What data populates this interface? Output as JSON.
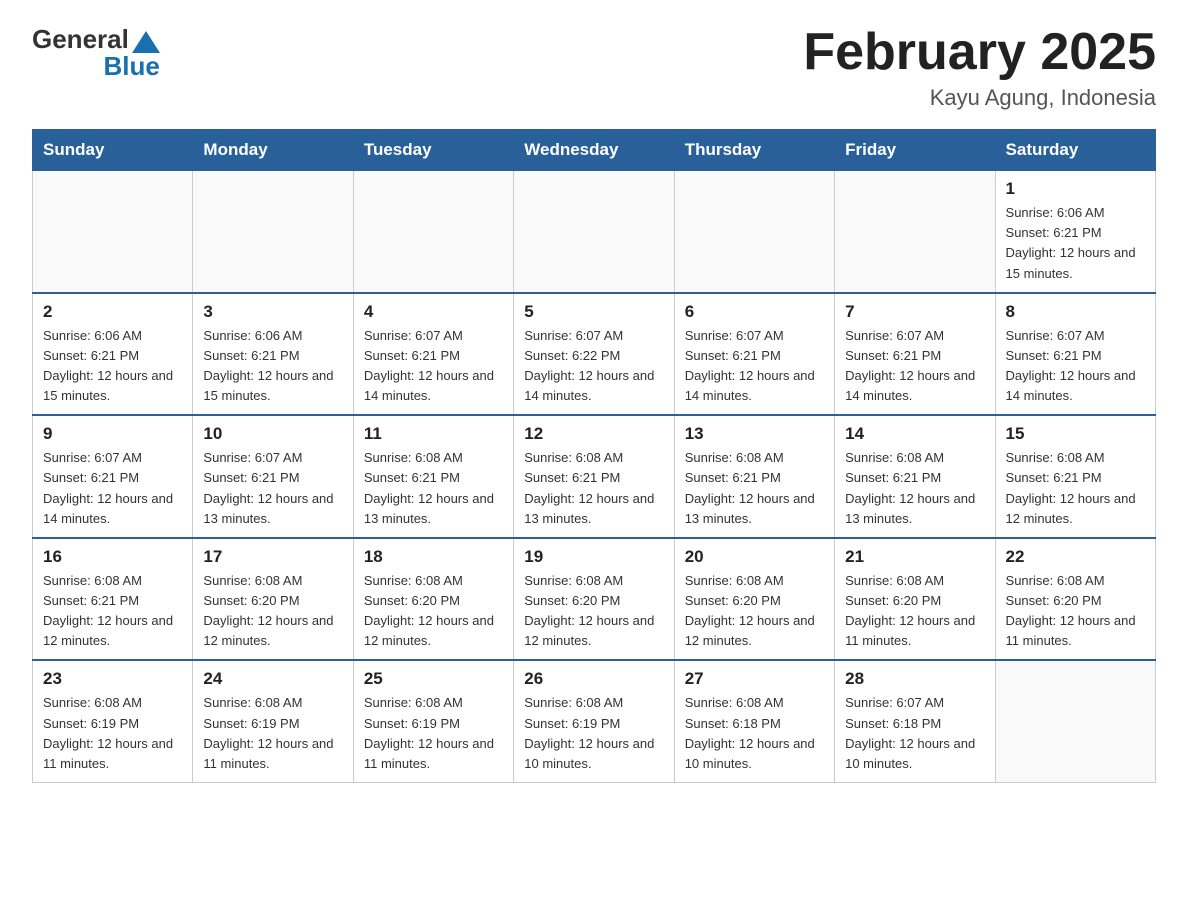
{
  "header": {
    "logo_general": "General",
    "logo_blue": "Blue",
    "title": "February 2025",
    "subtitle": "Kayu Agung, Indonesia"
  },
  "weekdays": [
    "Sunday",
    "Monday",
    "Tuesday",
    "Wednesday",
    "Thursday",
    "Friday",
    "Saturday"
  ],
  "weeks": [
    [
      {
        "day": "",
        "info": ""
      },
      {
        "day": "",
        "info": ""
      },
      {
        "day": "",
        "info": ""
      },
      {
        "day": "",
        "info": ""
      },
      {
        "day": "",
        "info": ""
      },
      {
        "day": "",
        "info": ""
      },
      {
        "day": "1",
        "info": "Sunrise: 6:06 AM\nSunset: 6:21 PM\nDaylight: 12 hours and 15 minutes."
      }
    ],
    [
      {
        "day": "2",
        "info": "Sunrise: 6:06 AM\nSunset: 6:21 PM\nDaylight: 12 hours and 15 minutes."
      },
      {
        "day": "3",
        "info": "Sunrise: 6:06 AM\nSunset: 6:21 PM\nDaylight: 12 hours and 15 minutes."
      },
      {
        "day": "4",
        "info": "Sunrise: 6:07 AM\nSunset: 6:21 PM\nDaylight: 12 hours and 14 minutes."
      },
      {
        "day": "5",
        "info": "Sunrise: 6:07 AM\nSunset: 6:22 PM\nDaylight: 12 hours and 14 minutes."
      },
      {
        "day": "6",
        "info": "Sunrise: 6:07 AM\nSunset: 6:21 PM\nDaylight: 12 hours and 14 minutes."
      },
      {
        "day": "7",
        "info": "Sunrise: 6:07 AM\nSunset: 6:21 PM\nDaylight: 12 hours and 14 minutes."
      },
      {
        "day": "8",
        "info": "Sunrise: 6:07 AM\nSunset: 6:21 PM\nDaylight: 12 hours and 14 minutes."
      }
    ],
    [
      {
        "day": "9",
        "info": "Sunrise: 6:07 AM\nSunset: 6:21 PM\nDaylight: 12 hours and 14 minutes."
      },
      {
        "day": "10",
        "info": "Sunrise: 6:07 AM\nSunset: 6:21 PM\nDaylight: 12 hours and 13 minutes."
      },
      {
        "day": "11",
        "info": "Sunrise: 6:08 AM\nSunset: 6:21 PM\nDaylight: 12 hours and 13 minutes."
      },
      {
        "day": "12",
        "info": "Sunrise: 6:08 AM\nSunset: 6:21 PM\nDaylight: 12 hours and 13 minutes."
      },
      {
        "day": "13",
        "info": "Sunrise: 6:08 AM\nSunset: 6:21 PM\nDaylight: 12 hours and 13 minutes."
      },
      {
        "day": "14",
        "info": "Sunrise: 6:08 AM\nSunset: 6:21 PM\nDaylight: 12 hours and 13 minutes."
      },
      {
        "day": "15",
        "info": "Sunrise: 6:08 AM\nSunset: 6:21 PM\nDaylight: 12 hours and 12 minutes."
      }
    ],
    [
      {
        "day": "16",
        "info": "Sunrise: 6:08 AM\nSunset: 6:21 PM\nDaylight: 12 hours and 12 minutes."
      },
      {
        "day": "17",
        "info": "Sunrise: 6:08 AM\nSunset: 6:20 PM\nDaylight: 12 hours and 12 minutes."
      },
      {
        "day": "18",
        "info": "Sunrise: 6:08 AM\nSunset: 6:20 PM\nDaylight: 12 hours and 12 minutes."
      },
      {
        "day": "19",
        "info": "Sunrise: 6:08 AM\nSunset: 6:20 PM\nDaylight: 12 hours and 12 minutes."
      },
      {
        "day": "20",
        "info": "Sunrise: 6:08 AM\nSunset: 6:20 PM\nDaylight: 12 hours and 12 minutes."
      },
      {
        "day": "21",
        "info": "Sunrise: 6:08 AM\nSunset: 6:20 PM\nDaylight: 12 hours and 11 minutes."
      },
      {
        "day": "22",
        "info": "Sunrise: 6:08 AM\nSunset: 6:20 PM\nDaylight: 12 hours and 11 minutes."
      }
    ],
    [
      {
        "day": "23",
        "info": "Sunrise: 6:08 AM\nSunset: 6:19 PM\nDaylight: 12 hours and 11 minutes."
      },
      {
        "day": "24",
        "info": "Sunrise: 6:08 AM\nSunset: 6:19 PM\nDaylight: 12 hours and 11 minutes."
      },
      {
        "day": "25",
        "info": "Sunrise: 6:08 AM\nSunset: 6:19 PM\nDaylight: 12 hours and 11 minutes."
      },
      {
        "day": "26",
        "info": "Sunrise: 6:08 AM\nSunset: 6:19 PM\nDaylight: 12 hours and 10 minutes."
      },
      {
        "day": "27",
        "info": "Sunrise: 6:08 AM\nSunset: 6:18 PM\nDaylight: 12 hours and 10 minutes."
      },
      {
        "day": "28",
        "info": "Sunrise: 6:07 AM\nSunset: 6:18 PM\nDaylight: 12 hours and 10 minutes."
      },
      {
        "day": "",
        "info": ""
      }
    ]
  ]
}
